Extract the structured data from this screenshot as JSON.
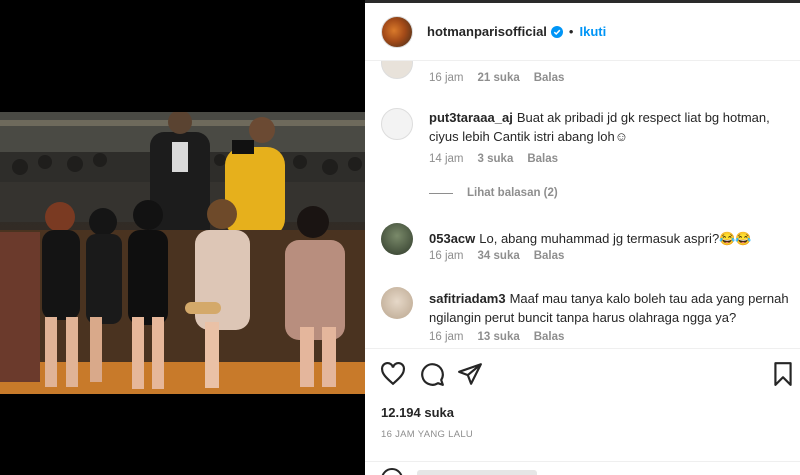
{
  "post": {
    "username": "hotmanparisofficial",
    "follow_label": "Ikuti",
    "dot": "•",
    "likes": "12.194 suka",
    "time_ago": "16 JAM YANG LALU"
  },
  "first_comment_meta": {
    "time": "16 jam",
    "likes": "21 suka",
    "reply": "Balas"
  },
  "comments": [
    {
      "user": "put3taraaa_aj",
      "text": "Buat ak pribadi jd gk respect liat bg hotman, ciyus lebih Cantik istri abang loh☺",
      "time": "14 jam",
      "likes": "3 suka",
      "reply": "Balas"
    },
    {
      "user": "053acw",
      "text": "Lo, abang muhammad jg termasuk aspri?😂😂",
      "time": "16 jam",
      "likes": "34 suka",
      "reply": "Balas"
    },
    {
      "user": "safitriadam3",
      "text": "Maaf mau tanya kalo boleh tau ada yang pernah ngilangin perut buncit tanpa harus olahraga ngga ya?",
      "time": "16 jam",
      "likes": "13 suka",
      "reply": "Balas"
    }
  ],
  "view_replies": "Lihat balasan (2)",
  "icons": {
    "like": "heart-icon",
    "comment": "comment-icon",
    "share": "paper-plane-icon",
    "save": "bookmark-icon",
    "verified": "verified-badge-icon"
  },
  "colors": {
    "accent": "#0095f6",
    "text": "#262626",
    "muted": "#8e8e8e"
  }
}
